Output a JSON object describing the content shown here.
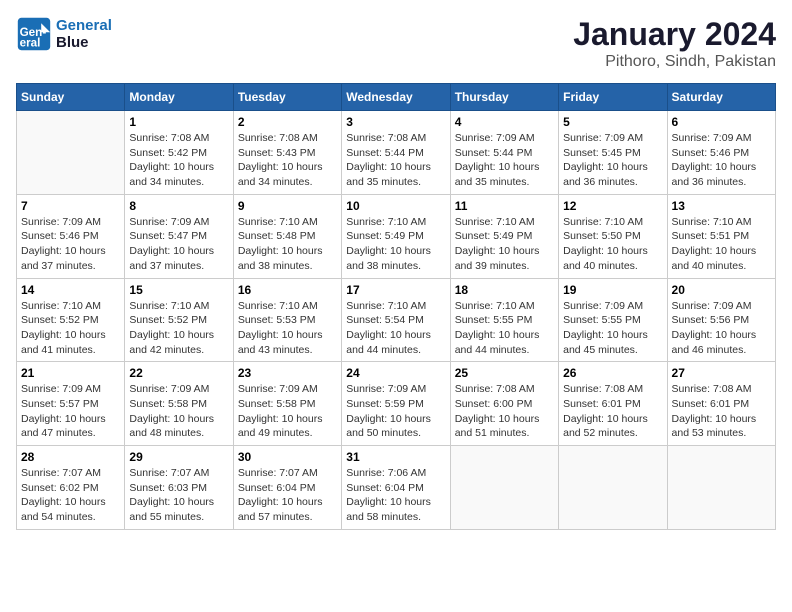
{
  "header": {
    "logo_line1": "General",
    "logo_line2": "Blue",
    "month": "January 2024",
    "location": "Pithoro, Sindh, Pakistan"
  },
  "days_of_week": [
    "Sunday",
    "Monday",
    "Tuesday",
    "Wednesday",
    "Thursday",
    "Friday",
    "Saturday"
  ],
  "weeks": [
    [
      {
        "day": "",
        "sunrise": "",
        "sunset": "",
        "daylight": ""
      },
      {
        "day": "1",
        "sunrise": "Sunrise: 7:08 AM",
        "sunset": "Sunset: 5:42 PM",
        "daylight": "Daylight: 10 hours and 34 minutes."
      },
      {
        "day": "2",
        "sunrise": "Sunrise: 7:08 AM",
        "sunset": "Sunset: 5:43 PM",
        "daylight": "Daylight: 10 hours and 34 minutes."
      },
      {
        "day": "3",
        "sunrise": "Sunrise: 7:08 AM",
        "sunset": "Sunset: 5:44 PM",
        "daylight": "Daylight: 10 hours and 35 minutes."
      },
      {
        "day": "4",
        "sunrise": "Sunrise: 7:09 AM",
        "sunset": "Sunset: 5:44 PM",
        "daylight": "Daylight: 10 hours and 35 minutes."
      },
      {
        "day": "5",
        "sunrise": "Sunrise: 7:09 AM",
        "sunset": "Sunset: 5:45 PM",
        "daylight": "Daylight: 10 hours and 36 minutes."
      },
      {
        "day": "6",
        "sunrise": "Sunrise: 7:09 AM",
        "sunset": "Sunset: 5:46 PM",
        "daylight": "Daylight: 10 hours and 36 minutes."
      }
    ],
    [
      {
        "day": "7",
        "sunrise": "Sunrise: 7:09 AM",
        "sunset": "Sunset: 5:46 PM",
        "daylight": "Daylight: 10 hours and 37 minutes."
      },
      {
        "day": "8",
        "sunrise": "Sunrise: 7:09 AM",
        "sunset": "Sunset: 5:47 PM",
        "daylight": "Daylight: 10 hours and 37 minutes."
      },
      {
        "day": "9",
        "sunrise": "Sunrise: 7:10 AM",
        "sunset": "Sunset: 5:48 PM",
        "daylight": "Daylight: 10 hours and 38 minutes."
      },
      {
        "day": "10",
        "sunrise": "Sunrise: 7:10 AM",
        "sunset": "Sunset: 5:49 PM",
        "daylight": "Daylight: 10 hours and 38 minutes."
      },
      {
        "day": "11",
        "sunrise": "Sunrise: 7:10 AM",
        "sunset": "Sunset: 5:49 PM",
        "daylight": "Daylight: 10 hours and 39 minutes."
      },
      {
        "day": "12",
        "sunrise": "Sunrise: 7:10 AM",
        "sunset": "Sunset: 5:50 PM",
        "daylight": "Daylight: 10 hours and 40 minutes."
      },
      {
        "day": "13",
        "sunrise": "Sunrise: 7:10 AM",
        "sunset": "Sunset: 5:51 PM",
        "daylight": "Daylight: 10 hours and 40 minutes."
      }
    ],
    [
      {
        "day": "14",
        "sunrise": "Sunrise: 7:10 AM",
        "sunset": "Sunset: 5:52 PM",
        "daylight": "Daylight: 10 hours and 41 minutes."
      },
      {
        "day": "15",
        "sunrise": "Sunrise: 7:10 AM",
        "sunset": "Sunset: 5:52 PM",
        "daylight": "Daylight: 10 hours and 42 minutes."
      },
      {
        "day": "16",
        "sunrise": "Sunrise: 7:10 AM",
        "sunset": "Sunset: 5:53 PM",
        "daylight": "Daylight: 10 hours and 43 minutes."
      },
      {
        "day": "17",
        "sunrise": "Sunrise: 7:10 AM",
        "sunset": "Sunset: 5:54 PM",
        "daylight": "Daylight: 10 hours and 44 minutes."
      },
      {
        "day": "18",
        "sunrise": "Sunrise: 7:10 AM",
        "sunset": "Sunset: 5:55 PM",
        "daylight": "Daylight: 10 hours and 44 minutes."
      },
      {
        "day": "19",
        "sunrise": "Sunrise: 7:09 AM",
        "sunset": "Sunset: 5:55 PM",
        "daylight": "Daylight: 10 hours and 45 minutes."
      },
      {
        "day": "20",
        "sunrise": "Sunrise: 7:09 AM",
        "sunset": "Sunset: 5:56 PM",
        "daylight": "Daylight: 10 hours and 46 minutes."
      }
    ],
    [
      {
        "day": "21",
        "sunrise": "Sunrise: 7:09 AM",
        "sunset": "Sunset: 5:57 PM",
        "daylight": "Daylight: 10 hours and 47 minutes."
      },
      {
        "day": "22",
        "sunrise": "Sunrise: 7:09 AM",
        "sunset": "Sunset: 5:58 PM",
        "daylight": "Daylight: 10 hours and 48 minutes."
      },
      {
        "day": "23",
        "sunrise": "Sunrise: 7:09 AM",
        "sunset": "Sunset: 5:58 PM",
        "daylight": "Daylight: 10 hours and 49 minutes."
      },
      {
        "day": "24",
        "sunrise": "Sunrise: 7:09 AM",
        "sunset": "Sunset: 5:59 PM",
        "daylight": "Daylight: 10 hours and 50 minutes."
      },
      {
        "day": "25",
        "sunrise": "Sunrise: 7:08 AM",
        "sunset": "Sunset: 6:00 PM",
        "daylight": "Daylight: 10 hours and 51 minutes."
      },
      {
        "day": "26",
        "sunrise": "Sunrise: 7:08 AM",
        "sunset": "Sunset: 6:01 PM",
        "daylight": "Daylight: 10 hours and 52 minutes."
      },
      {
        "day": "27",
        "sunrise": "Sunrise: 7:08 AM",
        "sunset": "Sunset: 6:01 PM",
        "daylight": "Daylight: 10 hours and 53 minutes."
      }
    ],
    [
      {
        "day": "28",
        "sunrise": "Sunrise: 7:07 AM",
        "sunset": "Sunset: 6:02 PM",
        "daylight": "Daylight: 10 hours and 54 minutes."
      },
      {
        "day": "29",
        "sunrise": "Sunrise: 7:07 AM",
        "sunset": "Sunset: 6:03 PM",
        "daylight": "Daylight: 10 hours and 55 minutes."
      },
      {
        "day": "30",
        "sunrise": "Sunrise: 7:07 AM",
        "sunset": "Sunset: 6:04 PM",
        "daylight": "Daylight: 10 hours and 57 minutes."
      },
      {
        "day": "31",
        "sunrise": "Sunrise: 7:06 AM",
        "sunset": "Sunset: 6:04 PM",
        "daylight": "Daylight: 10 hours and 58 minutes."
      },
      {
        "day": "",
        "sunrise": "",
        "sunset": "",
        "daylight": ""
      },
      {
        "day": "",
        "sunrise": "",
        "sunset": "",
        "daylight": ""
      },
      {
        "day": "",
        "sunrise": "",
        "sunset": "",
        "daylight": ""
      }
    ]
  ]
}
